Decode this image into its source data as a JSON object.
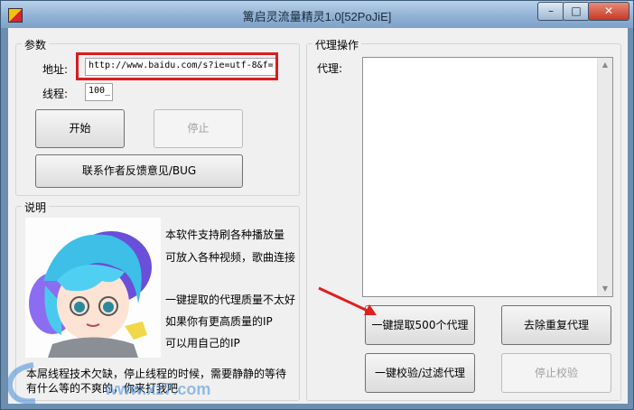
{
  "window": {
    "title": "篱启灵流量精灵1.0[52PoJiE]"
  },
  "window_controls": {
    "minimize": "–",
    "maximize": "□",
    "close": "✕"
  },
  "params": {
    "group_label": "参数",
    "address_label": "地址:",
    "address_value": "http://www.baidu.com/s?ie=utf-8&f=",
    "threads_label": "线程:",
    "threads_value": "100_",
    "start_label": "开始",
    "stop_label": "停止",
    "contact_label": "联系作者反馈意见/BUG"
  },
  "description": {
    "group_label": "说明",
    "lines": [
      "本软件支持刷各种播放量",
      "可放入各种视频，歌曲连接",
      "",
      "一键提取的代理质量不太好",
      "如果你有更高质量的IP",
      "可以用自己的IP"
    ],
    "footer_line1": "本屌线程技术欠缺，停止线程的时候，需要静静的等待",
    "footer_line2": "有什么等的不爽的，你来打我吧"
  },
  "proxy": {
    "group_label": "代理操作",
    "proxy_label": "代理:",
    "extract_label": "一键提取500个代理",
    "dedupe_label": "去除重复代理",
    "verify_label": "一键校验/过滤代理",
    "stop_verify_label": "停止校验"
  },
  "watermark": {
    "text": "www.xz7.com"
  },
  "colors": {
    "highlight_box": "#d81e1e",
    "arrow": "#e0201e",
    "close_button": "#c53a24"
  }
}
